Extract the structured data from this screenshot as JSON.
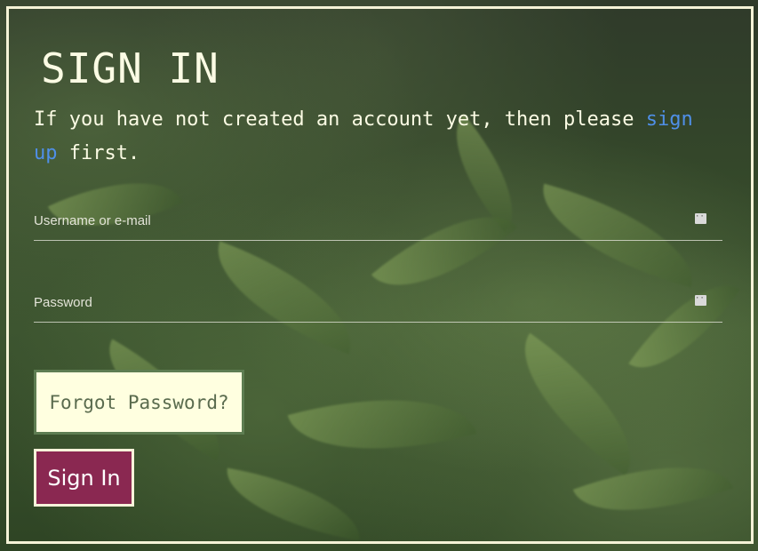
{
  "heading": "SIGN IN",
  "intro": {
    "text_before": "If you have not created an account yet, then please ",
    "link_text": "sign up",
    "text_after": " first."
  },
  "form": {
    "username": {
      "placeholder": "Username or e-mail",
      "value": "",
      "icon": "ellipsis-icon"
    },
    "password": {
      "placeholder": "Password",
      "value": "",
      "icon": "ellipsis-icon"
    }
  },
  "buttons": {
    "forgot_label": "Forgot Password?",
    "signin_label": "Sign In"
  },
  "colors": {
    "frame_border": "#f4f2d6",
    "link": "#4f8fe8",
    "forgot_bg": "#ffffe0",
    "forgot_border": "#5e7d52",
    "signin_bg": "#8a2851"
  }
}
